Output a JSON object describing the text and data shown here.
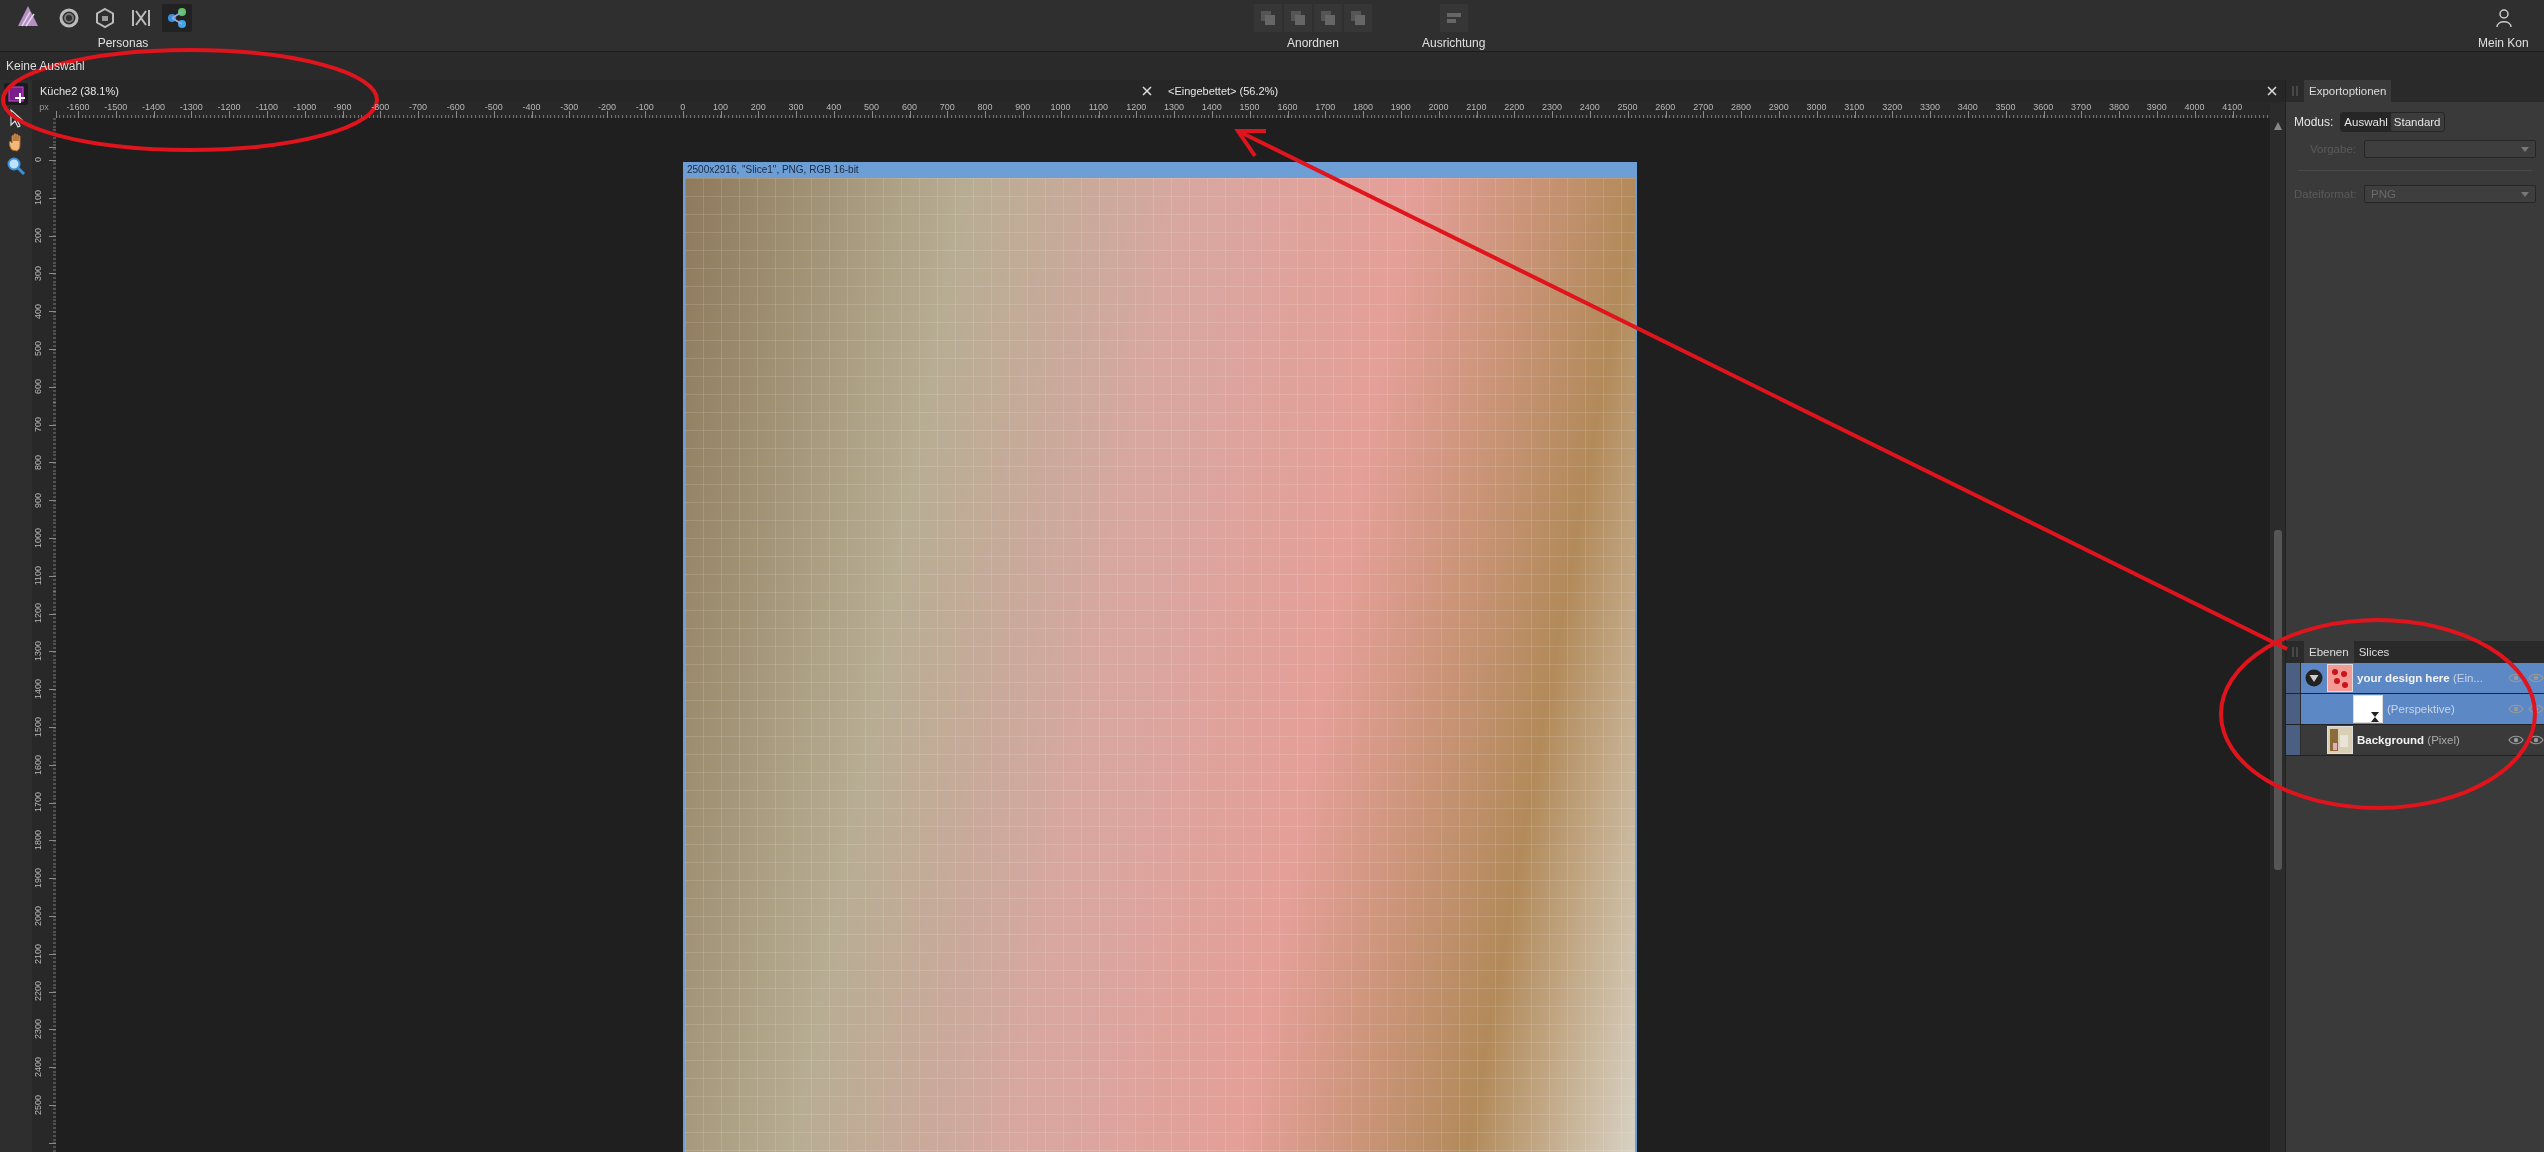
{
  "toolbar": {
    "personas": [
      {
        "kind": "ring",
        "selected": false
      },
      {
        "kind": "hexagon",
        "selected": false
      },
      {
        "kind": "bars",
        "selected": false
      },
      {
        "kind": "nodes",
        "selected": true
      }
    ],
    "personas_label": "Personas",
    "arrange_label": "Anordnen",
    "align_label": "Ausrichtung",
    "account_label": "Mein Kon"
  },
  "context_bar": {
    "text": "Keine Auswahl"
  },
  "tools": [
    {
      "kind": "slice",
      "selected": true
    },
    {
      "kind": "pointer",
      "selected": false
    },
    {
      "kind": "hand",
      "selected": false
    },
    {
      "kind": "zoom",
      "selected": false
    }
  ],
  "documents": [
    {
      "title": "Küche2 (38.1%)"
    },
    {
      "title": "<Eingebettet> (56.2%)"
    }
  ],
  "ruler": {
    "unit": "px",
    "horizontal": [
      "-1600",
      "-1500",
      "-1400",
      "-1300",
      "-1200",
      "-1100",
      "-1000",
      "-900",
      "-800",
      "-700",
      "-600",
      "-500",
      "-400",
      "-300",
      "-200",
      "-100",
      "0",
      "100",
      "200",
      "300",
      "400",
      "500",
      "600",
      "700",
      "800",
      "900",
      "1000",
      "1100",
      "1200",
      "1300",
      "1400",
      "1500",
      "1600",
      "1700",
      "1800",
      "1900",
      "2000",
      "2100",
      "2200",
      "2300",
      "2400",
      "2500",
      "2600",
      "2700",
      "2800",
      "2900",
      "3000",
      "3100",
      "3200",
      "3300",
      "3400",
      "3500",
      "3600",
      "3700",
      "3800",
      "3900",
      "4000",
      "4100"
    ],
    "vertical": [
      "0",
      "100",
      "200",
      "300",
      "400",
      "500",
      "600",
      "700",
      "800",
      "900",
      "1000",
      "1100",
      "1200",
      "1300",
      "1400",
      "1500",
      "1600",
      "1700",
      "1800",
      "1900",
      "2000",
      "2100",
      "2200",
      "2300",
      "2400",
      "2500"
    ]
  },
  "canvas": {
    "slice_label": "2500x2916, \"Slice1\", PNG, RGB 16-bit"
  },
  "export_panel": {
    "tab": "Exportoptionen",
    "mode_label": "Modus:",
    "modes": [
      {
        "label": "Auswahl",
        "selected": true
      },
      {
        "label": "Standard",
        "selected": false
      }
    ],
    "fields": [
      {
        "label": "Vorgabe:",
        "disabled": true
      },
      {
        "label": "Dateiformat:",
        "value": "PNG",
        "disabled": true
      }
    ]
  },
  "layers_panel": {
    "tabs": [
      {
        "label": "Ebenen",
        "selected": true
      },
      {
        "label": "Slices",
        "selected": false
      }
    ],
    "layers": [
      {
        "name": "your design here",
        "detail": "(Ein...",
        "kind": "poster",
        "selected": true,
        "expanded": true,
        "children": [
          {
            "detail": "(Perspektive)",
            "kind": "mask",
            "selected": true
          }
        ]
      },
      {
        "name": "Background",
        "detail": "(Pixel)",
        "kind": "photo",
        "selected": false
      }
    ]
  }
}
